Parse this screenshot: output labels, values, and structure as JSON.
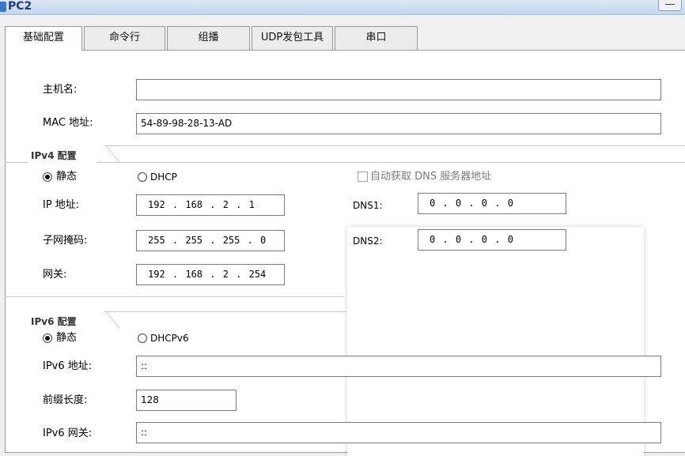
{
  "window": {
    "title": "PC2",
    "minimize_label": "—"
  },
  "tabs": [
    {
      "label": "基础配置",
      "active": true
    },
    {
      "label": "命令行",
      "active": false
    },
    {
      "label": "组播",
      "active": false
    },
    {
      "label": "UDP发包工具",
      "active": false
    },
    {
      "label": "串口",
      "active": false
    }
  ],
  "basic": {
    "hostname_label": "主机名:",
    "hostname_value": "",
    "mac_label": "MAC 地址:",
    "mac_value": "54-89-98-28-13-AD"
  },
  "ipv4": {
    "section_title": "IPv4 配置",
    "static_label": "静态",
    "dhcp_label": "DHCP",
    "selected_mode": "静态",
    "auto_dns_label": "自动获取 DNS 服务器地址",
    "auto_dns_checked": false,
    "ip_label": "IP 地址:",
    "ip_value": "192 . 168 .  2  .  1",
    "mask_label": "子网掩码:",
    "mask_value": "255 . 255 . 255 .  0",
    "gateway_label": "网关:",
    "gateway_value": "192 . 168 .  2  . 254",
    "dns1_label": "DNS1:",
    "dns1_value": "0  .  0  .  0  .  0",
    "dns2_label": "DNS2:",
    "dns2_value": "0  .  0  .  0  .  0"
  },
  "ipv6": {
    "section_title": "IPv6 配置",
    "static_label": "静态",
    "dhcp_label": "DHCPv6",
    "selected_mode": "静态",
    "ip_label": "IPv6 地址:",
    "ip_value": "::",
    "prefix_label": "前缀长度:",
    "prefix_value": "128",
    "gateway_label": "IPv6 网关:",
    "gateway_value": "::"
  }
}
